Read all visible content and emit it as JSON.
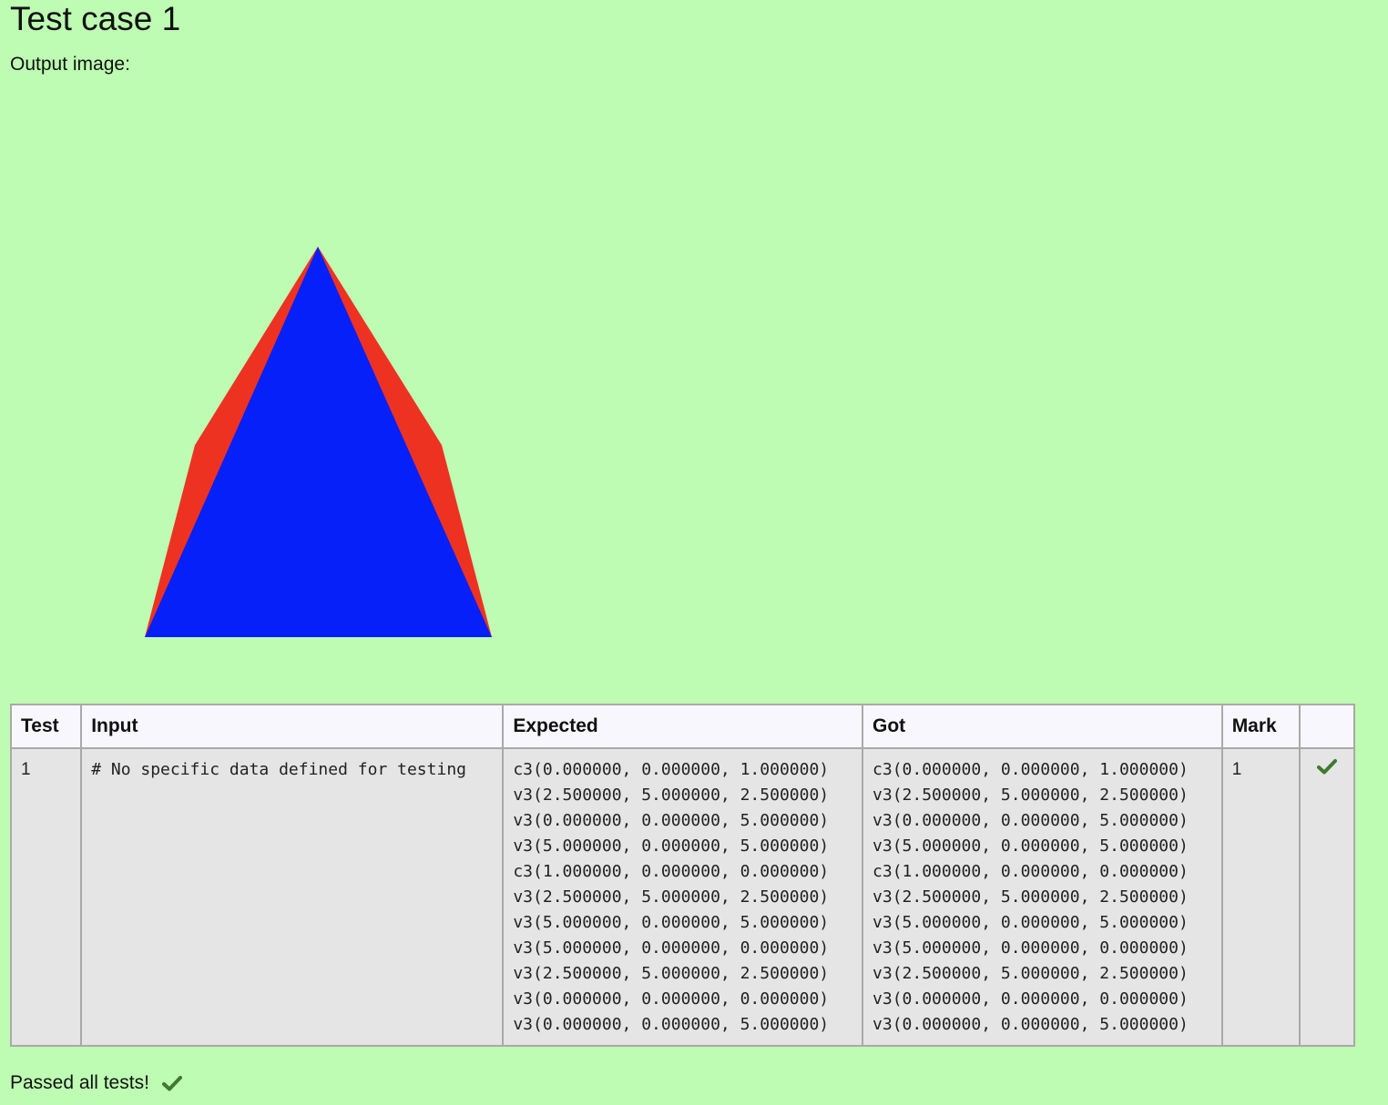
{
  "title": "Test case 1",
  "output_label": "Output image:",
  "output_image": {
    "background": "#bdfcb2",
    "back_color": "#ee3222",
    "front_color": "#0520f8"
  },
  "table": {
    "headers": {
      "test": "Test",
      "input": "Input",
      "expected": "Expected",
      "got": "Got",
      "mark": "Mark",
      "status": ""
    },
    "row": {
      "test": "1",
      "input": "# No specific data defined for testing",
      "expected": [
        "c3(0.000000, 0.000000, 1.000000)",
        "v3(2.500000, 5.000000, 2.500000)",
        "v3(0.000000, 0.000000, 5.000000)",
        "v3(5.000000, 0.000000, 5.000000)",
        "c3(1.000000, 0.000000, 0.000000)",
        "v3(2.500000, 5.000000, 2.500000)",
        "v3(5.000000, 0.000000, 5.000000)",
        "v3(5.000000, 0.000000, 0.000000)",
        "v3(2.500000, 5.000000, 2.500000)",
        "v3(0.000000, 0.000000, 0.000000)",
        "v3(0.000000, 0.000000, 5.000000)"
      ],
      "got": [
        "c3(0.000000, 0.000000, 1.000000)",
        "v3(2.500000, 5.000000, 2.500000)",
        "v3(0.000000, 0.000000, 5.000000)",
        "v3(5.000000, 0.000000, 5.000000)",
        "c3(1.000000, 0.000000, 0.000000)",
        "v3(2.500000, 5.000000, 2.500000)",
        "v3(5.000000, 0.000000, 5.000000)",
        "v3(5.000000, 0.000000, 0.000000)",
        "v3(2.500000, 5.000000, 2.500000)",
        "v3(0.000000, 0.000000, 0.000000)",
        "v3(0.000000, 0.000000, 5.000000)"
      ],
      "mark": "1",
      "status_icon": "checkmark-icon"
    }
  },
  "footer": {
    "text": "Passed all tests!",
    "icon": "checkmark-icon",
    "icon_color": "#3f7a2e"
  }
}
